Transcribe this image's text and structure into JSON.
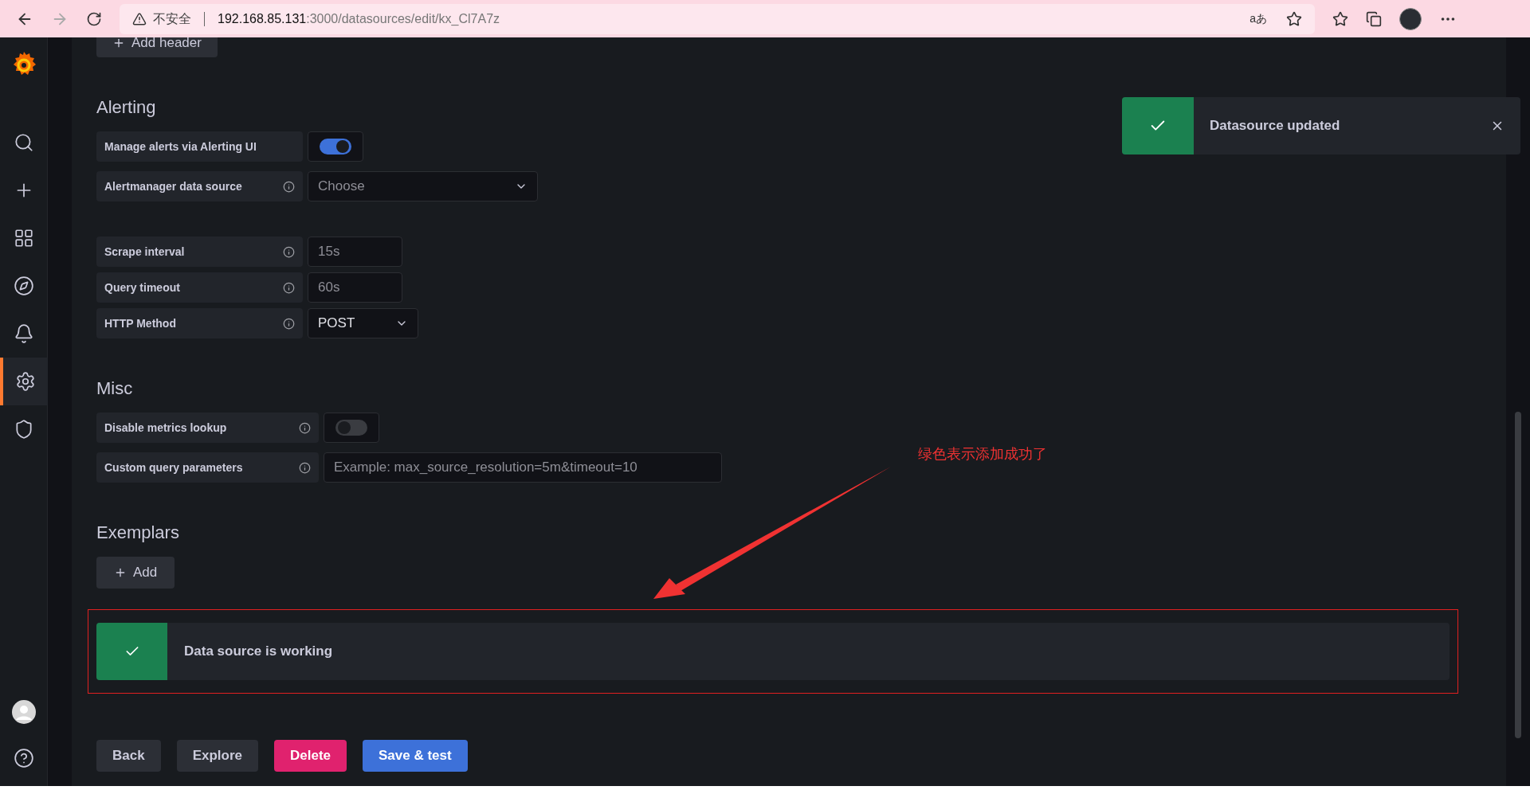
{
  "browser": {
    "security": "不安全",
    "host": "192.168.85.131",
    "path": ":3000/datasources/edit/kx_Cl7A7z",
    "translate": "aあ"
  },
  "sidebar": {
    "items": [
      {
        "selected": false
      },
      {
        "selected": false
      },
      {
        "selected": false
      },
      {
        "selected": false
      },
      {
        "selected": false
      },
      {
        "selected": true
      },
      {
        "selected": false
      }
    ]
  },
  "top_button": "Add header",
  "sections": [
    {
      "title": "Alerting",
      "groups": [
        [
          {
            "label": "Manage alerts via Alerting UI",
            "info": false,
            "kind": "switch",
            "on": true
          },
          {
            "label": "Alertmanager data source",
            "info": true,
            "kind": "select",
            "placeholder": "Choose"
          }
        ]
      ]
    },
    {
      "groups": [
        [
          {
            "label": "Scrape interval",
            "info": true,
            "kind": "input",
            "placeholder": "15s"
          },
          {
            "label": "Query timeout",
            "info": true,
            "kind": "input",
            "placeholder": "60s"
          },
          {
            "label": "HTTP Method",
            "info": true,
            "kind": "select",
            "value": "POST"
          }
        ]
      ]
    },
    {
      "title": "Misc",
      "groups": [
        [
          {
            "label": "Disable metrics lookup",
            "info": true,
            "kind": "switch",
            "on": false
          },
          {
            "label": "Custom query parameters",
            "info": true,
            "kind": "wideinput",
            "placeholder": "Example: max_source_resolution=5m&timeout=10"
          }
        ]
      ]
    },
    {
      "title": "Exemplars",
      "button": "Add"
    }
  ],
  "status_alert": {
    "text": "Data source is working"
  },
  "buttons": [
    {
      "label": "Back",
      "kind": "secondary"
    },
    {
      "label": "Explore",
      "kind": "secondary"
    },
    {
      "label": "Delete",
      "kind": "danger"
    },
    {
      "label": "Save & test",
      "kind": "primary"
    }
  ],
  "toast": {
    "text": "Datasource updated"
  },
  "annotation": {
    "text": "绿色表示添加成功了"
  }
}
